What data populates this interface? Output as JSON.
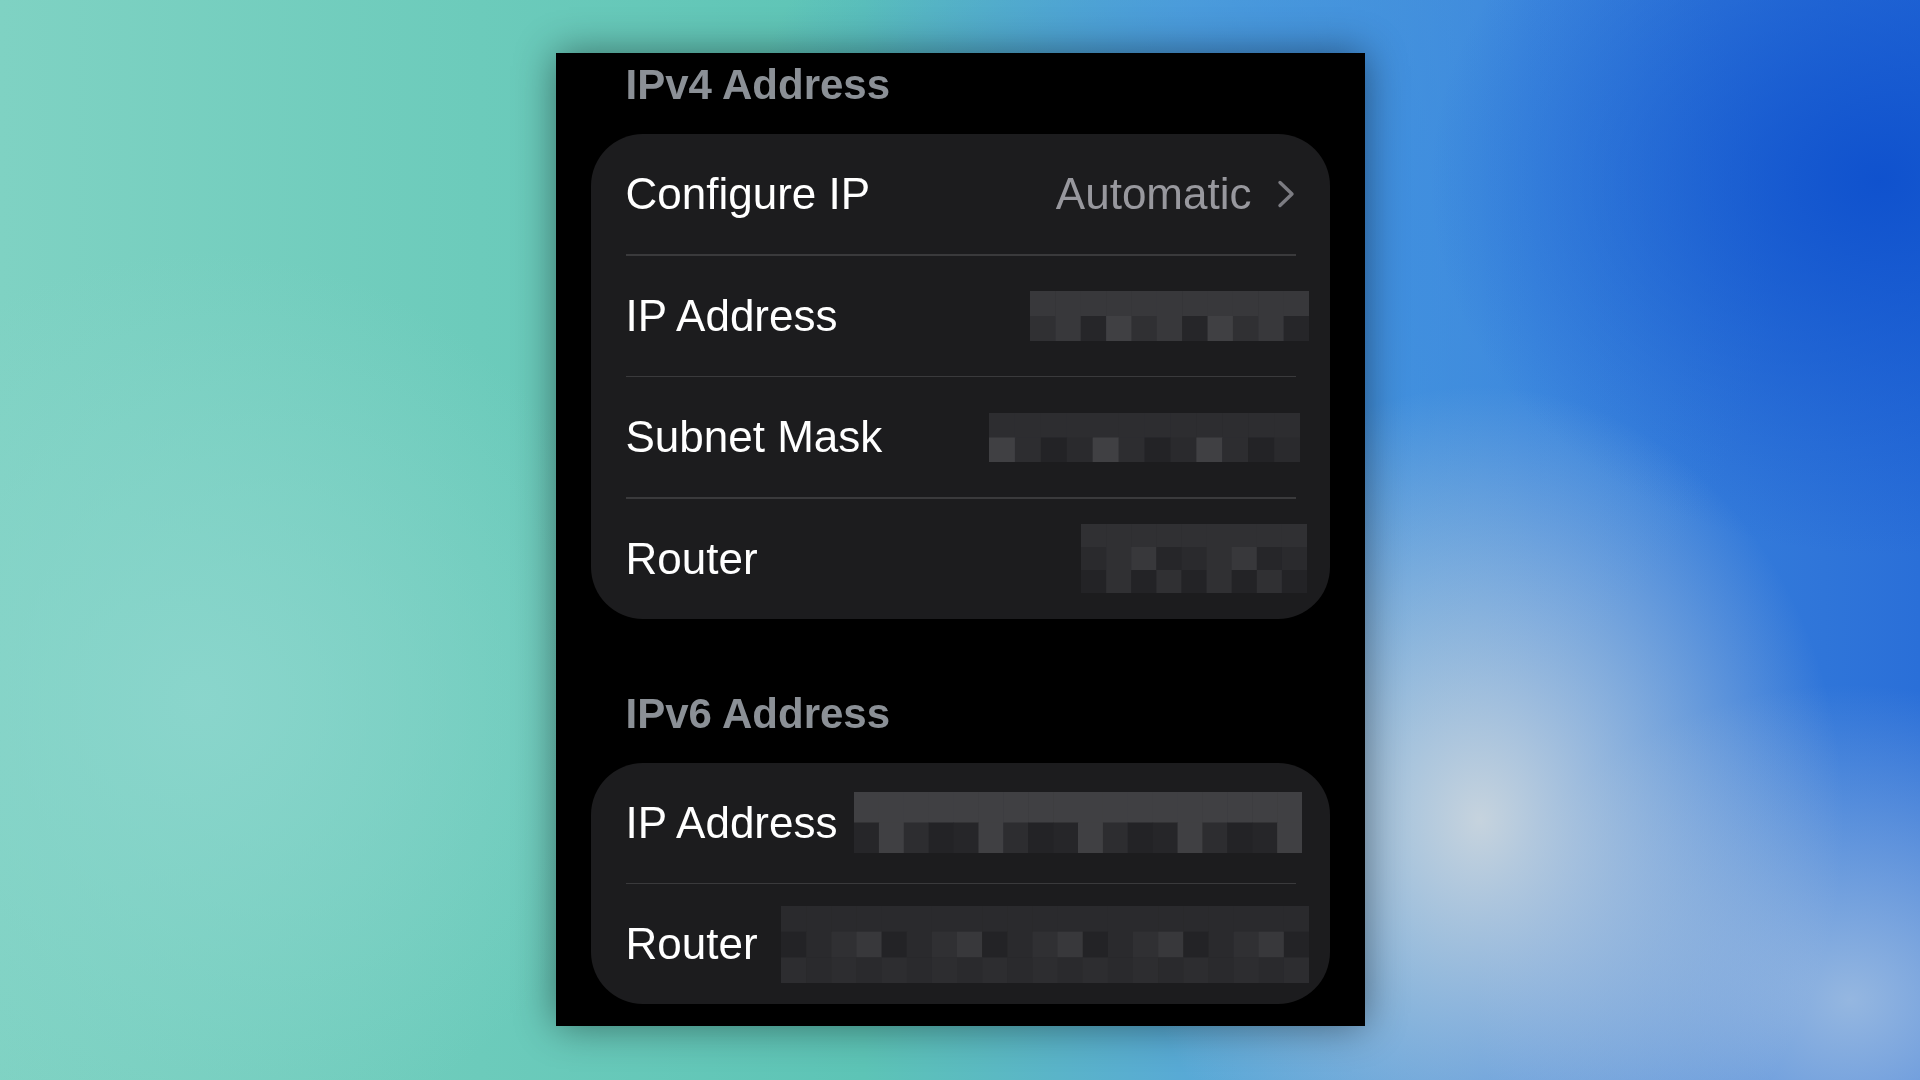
{
  "sections": [
    {
      "header": "IPv4 Address",
      "rows": [
        {
          "kind": "disclosure",
          "label": "Configure IP",
          "value": "Automatic"
        },
        {
          "kind": "redacted",
          "label": "IP Address"
        },
        {
          "kind": "redacted",
          "label": "Subnet Mask"
        },
        {
          "kind": "redacted",
          "label": "Router"
        }
      ]
    },
    {
      "header": "IPv6 Address",
      "rows": [
        {
          "kind": "redacted",
          "label": "IP Address"
        },
        {
          "kind": "redacted",
          "label": "Router"
        }
      ]
    }
  ]
}
